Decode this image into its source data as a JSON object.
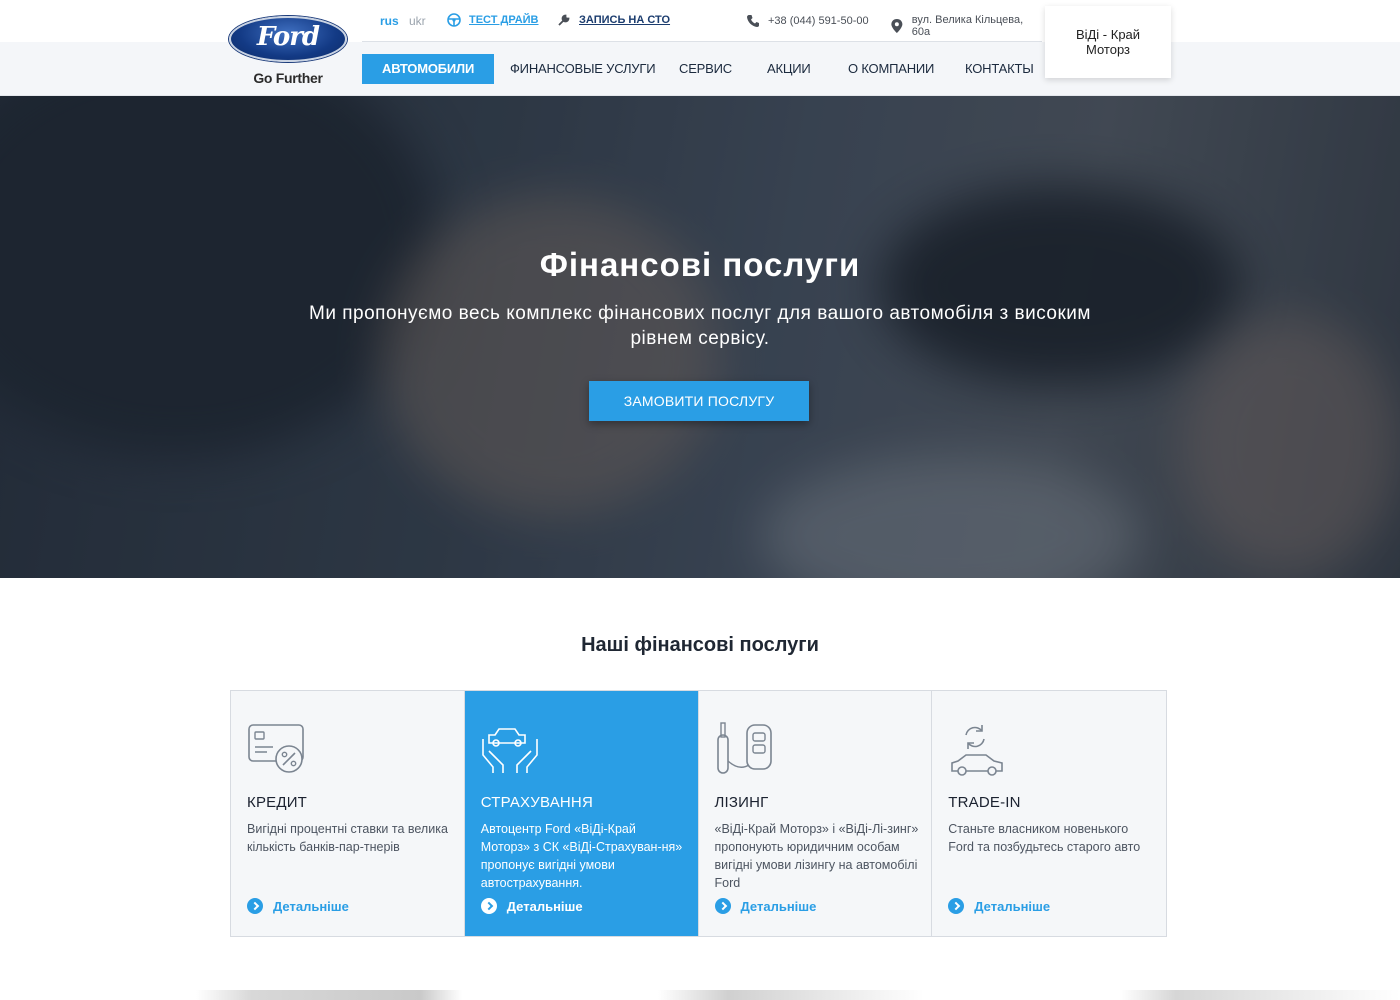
{
  "brand": {
    "logo_word": "Ford",
    "tagline": "Go Further"
  },
  "topbar": {
    "lang_rus": "rus",
    "lang_ukr": "ukr",
    "test_drive": "ТЕСТ ДРАЙВ",
    "service_booking": "ЗАПИСЬ НА СТО",
    "phone": "+38 (044) 591-50-00",
    "address": "вул. Велика Кільцева, 60а"
  },
  "nav": {
    "items": [
      {
        "label": "АВТОМОБИЛИ"
      },
      {
        "label": "ФИНАНСОВЫЕ УСЛУГИ"
      },
      {
        "label": "СЕРВИС"
      },
      {
        "label": "АКЦИИ"
      },
      {
        "label": "О КОМПАНИИ"
      },
      {
        "label": "КОНТАКТЫ"
      }
    ]
  },
  "dealer": {
    "name": "ВіДі - Край Моторз"
  },
  "hero": {
    "title": "Фінансові послуги",
    "subtitle": "Ми пропонуємо весь комплекс фінансових послуг для вашого автомобіля з високим рівнем сервісу.",
    "button": "ЗАМОВИТИ ПОСЛУГУ"
  },
  "services": {
    "title": "Наші фінансові послуги",
    "cards": [
      {
        "icon": "credit-card-percent-icon",
        "title": "КРЕДИТ",
        "desc": "Вигідні процентні ставки та велика кількість банків-пар-тнерів",
        "more": "Детальніше"
      },
      {
        "icon": "insurance-hands-car-icon",
        "title": "СТРАХУВАННЯ",
        "desc": "Автоцентр Ford «ВіДі-Край Моторз» з СК «ВіДі-Страхуван-ня» пропонує вигідні умови автострахування.",
        "more": "Детальніше"
      },
      {
        "icon": "leasing-key-icon",
        "title": "ЛІЗИНГ",
        "desc": "«ВіДі-Край Моторз» і «ВіДі-Лі-зинг» пропонують юридичним особам вигідні умови лізингу на автомобілі Ford",
        "more": "Детальніше"
      },
      {
        "icon": "trade-in-car-icon",
        "title": "TRADE-IN",
        "desc": "Станьте власником новенького Ford та позбудьтесь старого авто",
        "more": "Детальніше"
      }
    ]
  },
  "colors": {
    "accent": "#2a9ee5",
    "dark_blue": "#1b3c6e"
  }
}
